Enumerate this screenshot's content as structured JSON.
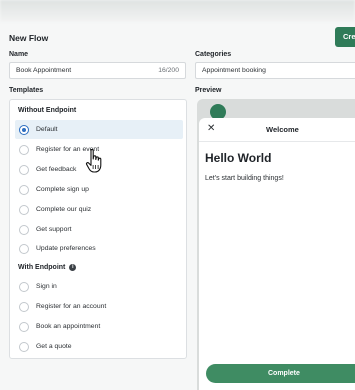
{
  "header": {
    "title": "New Flow",
    "create_label": "Cre"
  },
  "form": {
    "name_label": "Name",
    "name_value": "Book Appointment",
    "name_count": "16/200",
    "categories_label": "Categories",
    "categories_value": "Appointment booking",
    "templates_label": "Templates",
    "preview_label": "Preview"
  },
  "templates": {
    "without_endpoint_heading": "Without Endpoint",
    "without_endpoint": [
      {
        "label": "Default",
        "selected": true
      },
      {
        "label": "Register for an event",
        "selected": false
      },
      {
        "label": "Get feedback",
        "selected": false
      },
      {
        "label": "Complete sign up",
        "selected": false
      },
      {
        "label": "Complete our quiz",
        "selected": false
      },
      {
        "label": "Get support",
        "selected": false
      },
      {
        "label": "Update preferences",
        "selected": false
      }
    ],
    "with_endpoint_heading": "With Endpoint",
    "with_endpoint": [
      {
        "label": "Sign in",
        "selected": false
      },
      {
        "label": "Register for an account",
        "selected": false
      },
      {
        "label": "Book an appointment",
        "selected": false
      },
      {
        "label": "Get a quote",
        "selected": false
      }
    ]
  },
  "preview": {
    "close_symbol": "✕",
    "screen_title": "Welcome",
    "heading": "Hello World",
    "body": "Let's start building things!",
    "button_label": "Complete"
  },
  "colors": {
    "primary_green": "#2f7b58",
    "selected_bg": "#e7f0f7",
    "radio_selected": "#2d6ec0"
  }
}
